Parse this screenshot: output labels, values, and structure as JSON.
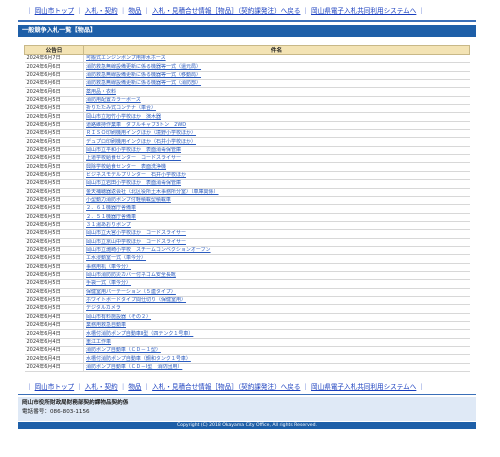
{
  "nav": {
    "links": [
      "岡山市トップ",
      "入札・契約",
      "物品",
      "入札・見積合せ情報［物品］（契約課発注）へ戻る",
      "岡山県電子入札共同利用システムへ"
    ]
  },
  "page_title": "一般競争入札一覧【物品】",
  "table": {
    "col_date": "公告日",
    "col_name": "件名",
    "rows": [
      {
        "date": "2024年6月7日",
        "name": "可搬式エンジンポンプ用排水ホース"
      },
      {
        "date": "2024年6月6日",
        "name": "消防救急無線設備更新に係る機器等一式（還元局）"
      },
      {
        "date": "2024年6月6日",
        "name": "消防救急無線設備更新に係る機器等一式（移動局）"
      },
      {
        "date": "2024年6月6日",
        "name": "消防救急無線設備更新に係る機器等一式（消防部）"
      },
      {
        "date": "2024年6月6日",
        "name": "薬用品・衣料"
      },
      {
        "date": "2024年6月5日",
        "name": "消防用配置カラーボース"
      },
      {
        "date": "2024年6月5日",
        "name": "折りたたみ式コンテナ（車合）"
      },
      {
        "date": "2024年6月5日",
        "name": "岡山市立旭竹小学校ほか　演木器"
      },
      {
        "date": "2024年6月5日",
        "name": "道路維持作業車　ダブルキャブ3トン　2WD"
      },
      {
        "date": "2024年6月5日",
        "name": "ＲＩＳＯ印刷機用インクほか（境野小学校ほか）"
      },
      {
        "date": "2024年6月5日",
        "name": "デュプロ印刷機用インクほか（石井小学校ほか）"
      },
      {
        "date": "2024年6月5日",
        "name": "岡山市立平和小学校ほか　表面消毒保管庫"
      },
      {
        "date": "2024年6月5日",
        "name": "上道学校給食センター　コードスライサー"
      },
      {
        "date": "2024年6月5日",
        "name": "興除学校給食センター　表面洗浄機"
      },
      {
        "date": "2024年6月5日",
        "name": "ビジネスモデルプリンター　石井小学校ほか"
      },
      {
        "date": "2024年6月5日",
        "name": "岡山市立岩田小学校ほか　表面消毒保管庫"
      },
      {
        "date": "2024年6月5日",
        "name": "金天補聴器返会社（北区役所土木事務所分室）（車庫関係）"
      },
      {
        "date": "2024年6月5日",
        "name": "小型動力消防ポンプ付軽積載型積載車"
      },
      {
        "date": "2024年6月5日",
        "name": "２．６１機器庁舎備車"
      },
      {
        "date": "2024年6月5日",
        "name": "２．５１機器庁舎備車"
      },
      {
        "date": "2024年6月5日",
        "name": "３１湯あおりポンプ"
      },
      {
        "date": "2024年6月5日",
        "name": "岡山市立大宮小学校ほか　コードスライサー"
      },
      {
        "date": "2024年6月5日",
        "name": "岡山市立京山中学校ほか　コードスライサー"
      },
      {
        "date": "2024年6月5日",
        "name": "岡山市立灘崎小学校　スチームコンベクションオーブン"
      },
      {
        "date": "2024年6月5日",
        "name": "エ水浸動室一式（車今分）"
      },
      {
        "date": "2024年6月5日",
        "name": "事務用机（車今分）"
      },
      {
        "date": "2024年6月5日",
        "name": "岡山市消防防災カバー付ネゴム安全長靴"
      },
      {
        "date": "2024年6月5日",
        "name": "手袋一式（車今分）"
      },
      {
        "date": "2024年6月5日",
        "name": "保健室用パーテーション（５連タイプ）"
      },
      {
        "date": "2024年6月5日",
        "name": "ホワイトボードタイプ間仕切り（保健室用）"
      },
      {
        "date": "2024年6月5日",
        "name": "デジタルカメラ"
      },
      {
        "date": "2024年6月4日",
        "name": "岡山市有料施設器（その２）"
      },
      {
        "date": "2024年6月4日",
        "name": "業務用救急自動車"
      },
      {
        "date": "2024年6月4日",
        "name": "水槽付消防ポンプ自動車Ⅱ型（四テンク１号車）"
      },
      {
        "date": "2024年6月4日",
        "name": "重江工作車"
      },
      {
        "date": "2024年6月4日",
        "name": "消防ポンプ自動車（ＣＤ－１型）"
      },
      {
        "date": "2024年6月4日",
        "name": "水槽付消防ポンプ自動車（鋼和タンク１号車）"
      },
      {
        "date": "2024年6月4日",
        "name": "消防ポンプ自動車（ＣＤ－Ⅰ型　消防団用）"
      }
    ]
  },
  "contact": {
    "org": "岡山市役所財政局財務部契約課物品契約係",
    "phone": "電話番号：086-803-1156"
  },
  "footer": "Copyright (C) 2018 Okayama City Office, All rights Reserved."
}
